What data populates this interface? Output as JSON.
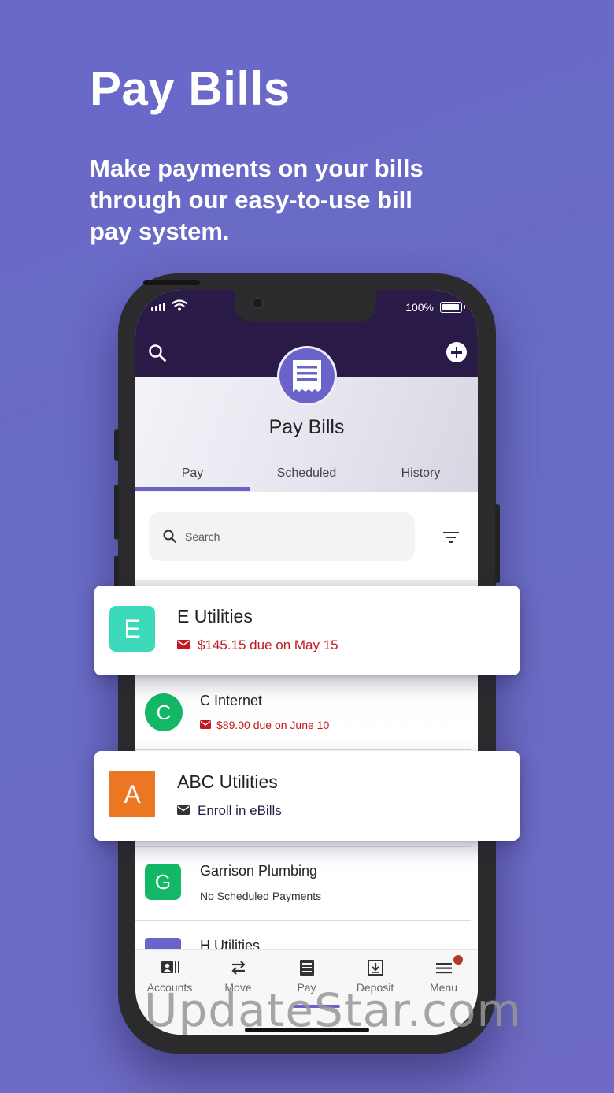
{
  "promo": {
    "title": "Pay Bills",
    "subtitle": "Make payments on your bills through our easy-to-use bill pay system."
  },
  "status_bar": {
    "battery": "100%"
  },
  "header": {
    "title": "Pay Bills",
    "search_icon": "search-icon",
    "add_icon": "plus-circle-icon",
    "badge_icon": "receipt-icon"
  },
  "tabs": [
    {
      "label": "Pay",
      "active": true
    },
    {
      "label": "Scheduled",
      "active": false
    },
    {
      "label": "History",
      "active": false
    }
  ],
  "search": {
    "placeholder": "Search"
  },
  "billers": [
    {
      "initial": "E",
      "name": "E Utilities",
      "status": "$145.15 due on May 15",
      "status_type": "due",
      "color": "#3dd9bb"
    },
    {
      "initial": "C",
      "name": "C Internet",
      "status": "$89.00 due on June 10",
      "status_type": "due",
      "color": "#12b865"
    },
    {
      "initial": "A",
      "name": "ABC Utilities",
      "status": "Enroll in eBills",
      "status_type": "enroll",
      "color": "#eb7722"
    },
    {
      "initial": "G",
      "name": "Garrison Plumbing",
      "status": "No Scheduled Payments",
      "status_type": "none",
      "color": "#12b865"
    },
    {
      "initial": "",
      "name": "H Utilities",
      "status": "",
      "status_type": "none",
      "color": "#6a63c9"
    }
  ],
  "bottom_nav": [
    {
      "label": "Accounts",
      "icon": "accounts-icon"
    },
    {
      "label": "Move",
      "icon": "transfer-arrows-icon"
    },
    {
      "label": "Pay",
      "icon": "receipt-icon",
      "active": true
    },
    {
      "label": "Deposit",
      "icon": "deposit-icon"
    },
    {
      "label": "Menu",
      "icon": "menu-icon",
      "badge": true
    }
  ],
  "colors": {
    "background": "#6a67c8",
    "header_dark": "#2a1a48",
    "accent": "#6a63c9",
    "due_red": "#c0181e"
  },
  "watermark": "UpdateStar.com"
}
